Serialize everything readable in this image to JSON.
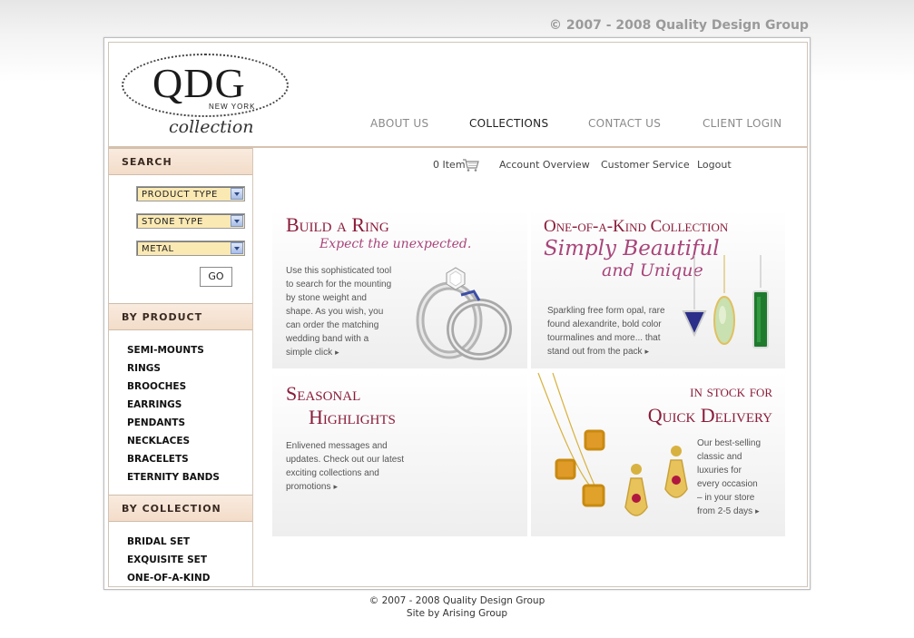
{
  "top_copyright": "© 2007 - 2008 Quality Design Group",
  "logo": {
    "mark": "QDG",
    "sub": "NEW YORK",
    "word": "collection"
  },
  "nav": [
    "ABOUT US",
    "COLLECTIONS",
    "CONTACT US",
    "CLIENT LOGIN"
  ],
  "utility": {
    "cart_count": "0 Item",
    "links": [
      "Account Overview",
      "Customer Service",
      "Logout"
    ]
  },
  "sidebar": {
    "search_title": "SEARCH",
    "selects": [
      "PRODUCT TYPE",
      "STONE TYPE",
      "METAL"
    ],
    "go_label": "GO",
    "by_product_title": "BY PRODUCT",
    "products": [
      "SEMI-MOUNTS",
      "RINGS",
      "BROOCHES",
      "EARRINGS",
      "PENDANTS",
      "NECKLACES",
      "BRACELETS",
      "ETERNITY BANDS"
    ],
    "by_collection_title": "BY COLLECTION",
    "collections": [
      "BRIDAL SET",
      "EXQUISITE SET",
      "ONE-OF-A-KIND"
    ]
  },
  "panels": {
    "ring": {
      "title": "Build a Ring",
      "tagline": "Expect the unexpected.",
      "lines": [
        "Use this sophisticated tool",
        "to search for the mounting",
        "by stone weight and",
        "shape. As you wish, you",
        "can order the matching",
        "wedding band with a",
        "simple click"
      ]
    },
    "one_of_a_kind": {
      "title": "One-of-a-Kind Collection",
      "script1": "Simply Beautiful",
      "script2": "and Unique",
      "lines": [
        "Sparkling free form opal, rare",
        "found alexandrite, bold color",
        "tourmalines and more... that",
        "stand out from the pack"
      ]
    },
    "seasonal": {
      "title1": "Seasonal",
      "title2": "Highlights",
      "lines": [
        "Enlivened messages and",
        "updates.  Check out our latest",
        "exciting collections and",
        "promotions"
      ]
    },
    "instock": {
      "title1": "in stock for",
      "title2": "Quick Delivery",
      "lines": [
        "Our best-selling",
        "classic and",
        "luxuries for",
        "every occasion",
        "– in your store",
        "from 2-5 days"
      ]
    }
  },
  "footer": {
    "line1": "© 2007 - 2008 Quality Design Group",
    "line2": "Site by Arising Group"
  },
  "colors": {
    "accent": "#8a1c3a",
    "section_bg": "#f6e3d4",
    "select_bg": "#fbe9b4"
  }
}
